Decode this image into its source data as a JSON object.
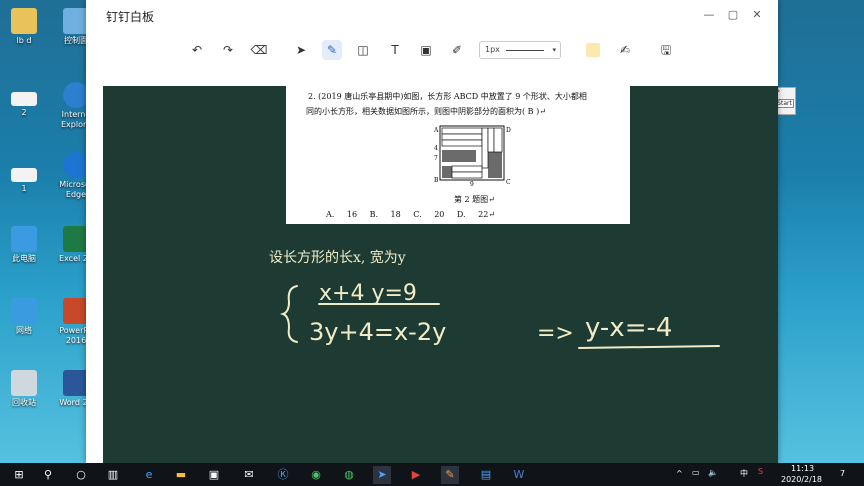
{
  "desktop": {
    "icons": [
      {
        "label": "lb d",
        "icon": "user-folder-icon"
      },
      {
        "label": "控制面",
        "icon": "control-panel-icon"
      },
      {
        "label": "2",
        "icon": "file-icon"
      },
      {
        "label": "Interne Explore",
        "icon": "internet-explorer-icon"
      },
      {
        "label": "1",
        "icon": "file-icon"
      },
      {
        "label": "Microsof Edge",
        "icon": "edge-icon"
      },
      {
        "label": "此电脑",
        "icon": "this-pc-icon"
      },
      {
        "label": "Excel 20",
        "icon": "excel-icon"
      },
      {
        "label": "网络",
        "icon": "network-icon"
      },
      {
        "label": "PowerPo 2016",
        "icon": "powerpoint-icon"
      },
      {
        "label": "回收站",
        "icon": "recycle-bin-icon"
      },
      {
        "label": "Word 20",
        "icon": "word-icon"
      }
    ]
  },
  "window": {
    "title": "钉钉白板",
    "controls": {
      "minimize": "—",
      "maximize": "▢",
      "close": "✕"
    },
    "toolbar": {
      "tools": [
        "undo-icon",
        "redo-icon",
        "eraser-icon",
        "pointer-icon",
        "pen-icon",
        "shape-icon",
        "text-icon",
        "image-icon",
        "highlighter-icon"
      ],
      "stroke_label": "1px",
      "color_hex": "#fde9ad",
      "extra": [
        "edit-icon",
        "save-icon"
      ]
    }
  },
  "paper": {
    "line1": "2. (2019 唐山乐亭县期中)如图，长方形 ABCD 中放置了 9 个形状、大小都相",
    "line2": "同的小长方形，相关数据如图所示，则图中阴影部分的面积为(    B    )↵",
    "caption": "第 2 题图↵",
    "options": "A. 16    B. 18    C. 20    D. 22↵",
    "figure_labels": {
      "a": "A",
      "d": "D",
      "b": "B",
      "c": "C",
      "nine": "9",
      "seven": "7",
      "four": "4"
    }
  },
  "board": {
    "typed_line": "设长方形的长x, 宽为y",
    "handwriting": [
      "x+4 y=9",
      "3y+4=x-2y",
      "=>",
      "y-x=-4"
    ]
  },
  "mini": {
    "label1": "P",
    "label2": "Start"
  },
  "taskbar": {
    "apps": [
      "start-icon",
      "search-icon",
      "cortana-icon",
      "task-view-icon",
      "edge-icon",
      "file-explorer-icon",
      "store-icon",
      "mail-icon",
      "k-app-icon",
      "green-app-icon",
      "wechat-icon",
      "dingtalk-icon",
      "red-app-icon",
      "whiteboard-icon",
      "blue-app-icon",
      "word-icon"
    ],
    "time": "11:13",
    "date": "2020/2/18",
    "ime": "中",
    "notif_count": "7"
  }
}
